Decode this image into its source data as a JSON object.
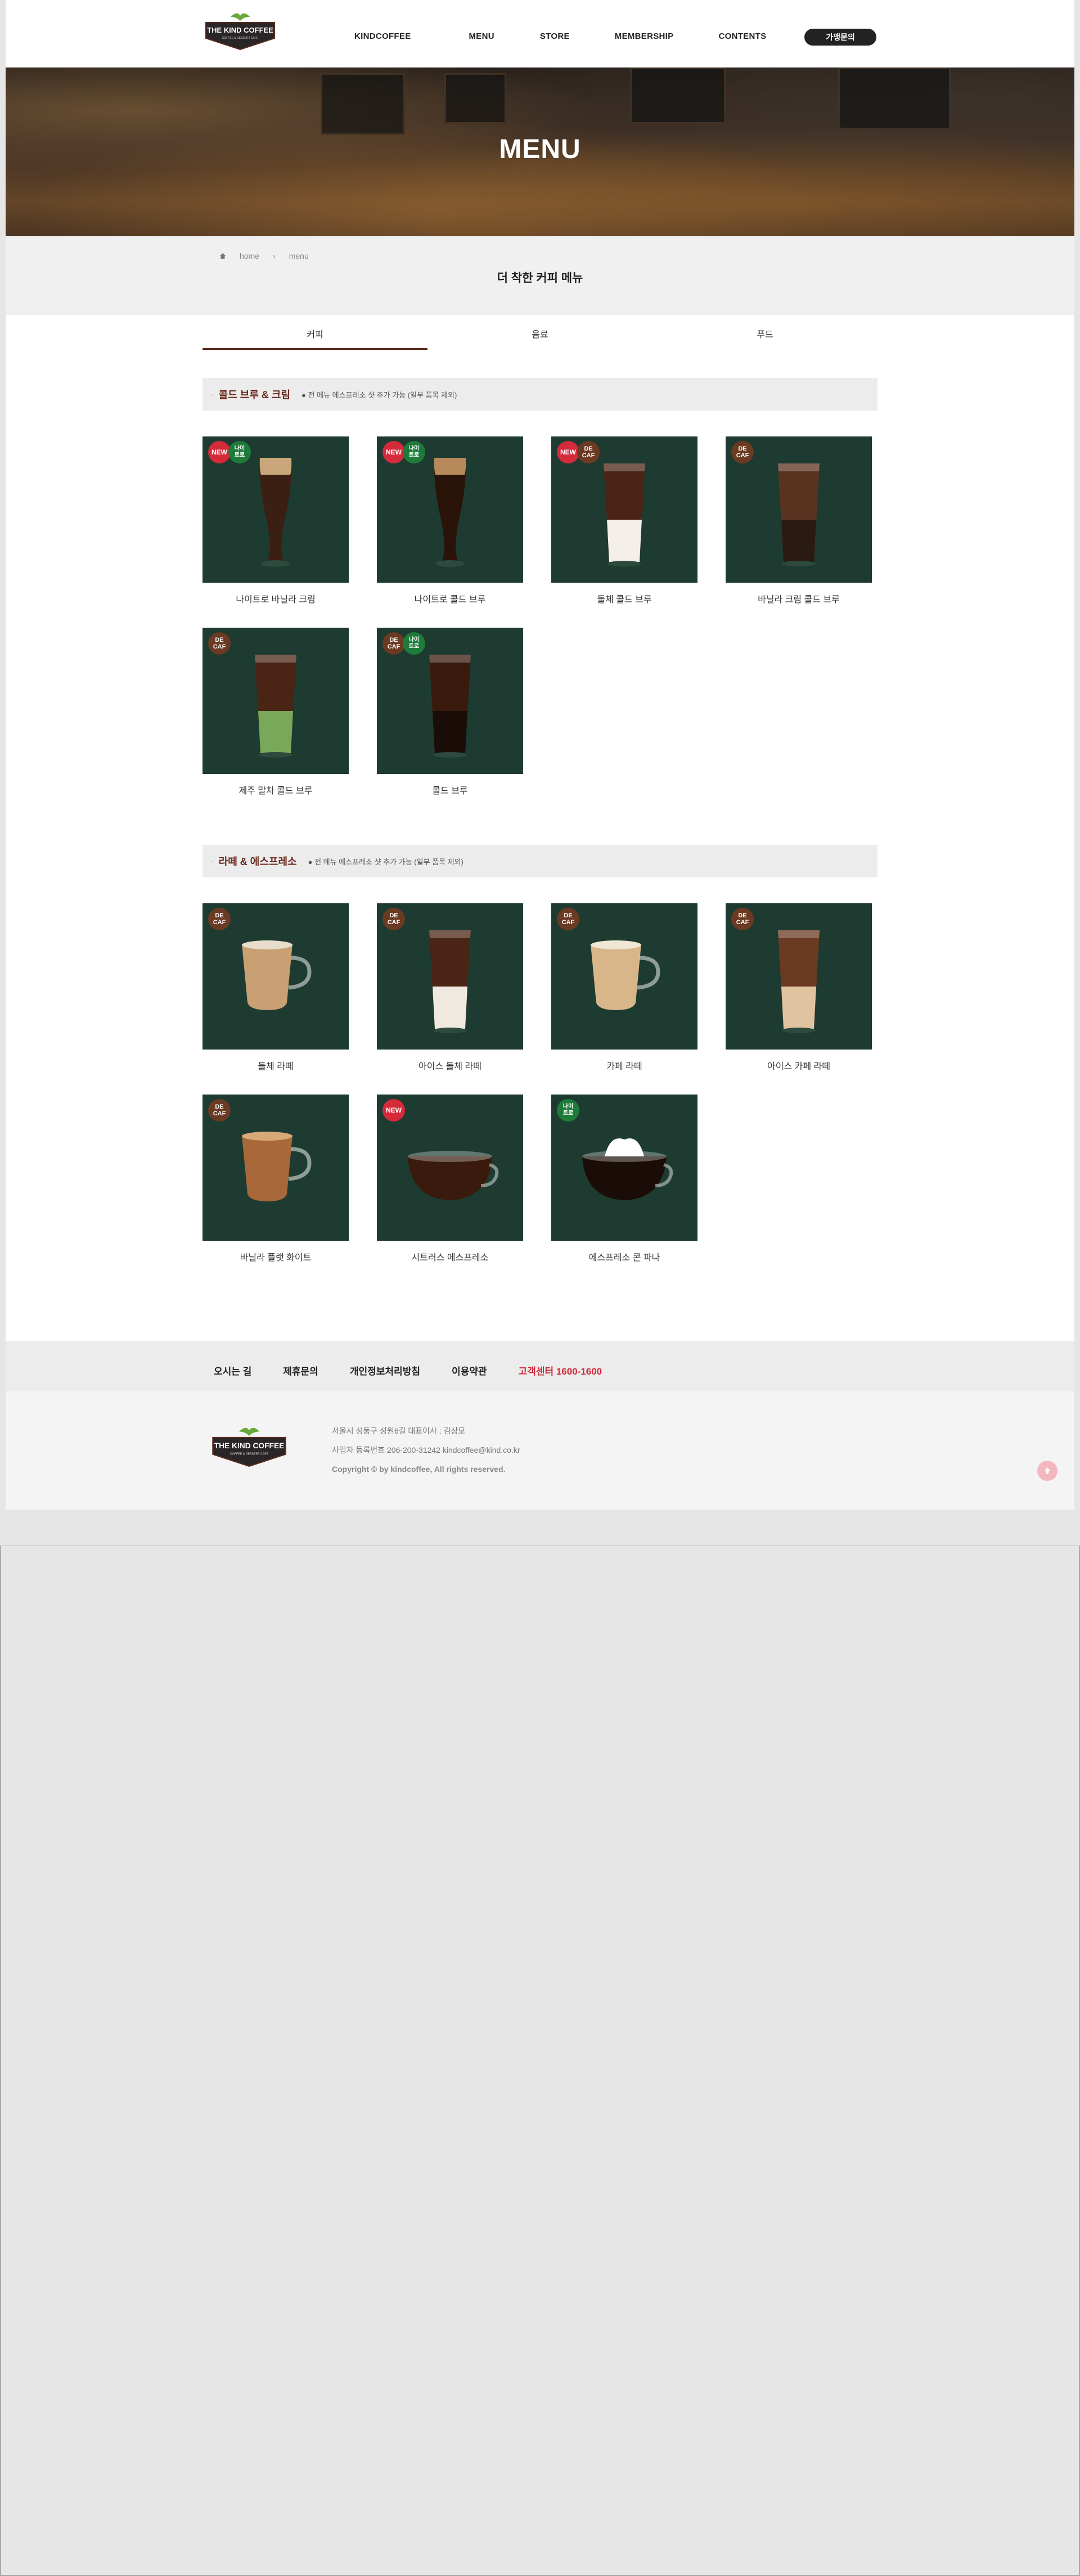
{
  "header": {
    "logo_text": "THE KIND COFFEE",
    "logo_sub": "COFFEE & DESSERT CAFE",
    "nav": [
      "KINDCOFFEE",
      "MENU",
      "STORE",
      "MEMBERSHIP",
      "CONTENTS"
    ],
    "cta_label": "가맹문의"
  },
  "hero": {
    "title": "MENU"
  },
  "breadcrumb": {
    "home": "home",
    "current": "menu"
  },
  "page_title": "더 착한 커피 메뉴",
  "tabs": [
    "커피",
    "음료",
    "푸드"
  ],
  "sections": [
    {
      "title": "콜드 브루 & 크림",
      "note": "전 메뉴 에스프레소 샷 추가 가능 (일부 품목 제외)",
      "items": [
        {
          "name": "나이트로 바닐라 크림",
          "badges": [
            "NEW",
            "나이트로"
          ]
        },
        {
          "name": "나이트로 콜드 브루",
          "badges": [
            "NEW",
            "나이트로"
          ]
        },
        {
          "name": "돌체 콜드 브루",
          "badges": [
            "NEW",
            "DECAF"
          ]
        },
        {
          "name": "바닐라 크림 콜드 브루",
          "badges": [
            "DECAF"
          ]
        },
        {
          "name": "제주 말차 콜드 브루",
          "badges": [
            "DECAF"
          ]
        },
        {
          "name": "콜드 브루",
          "badges": [
            "DECAF",
            "나이트로"
          ]
        }
      ]
    },
    {
      "title": "라떼 & 에스프레소",
      "note": "전 메뉴 에스프레소 샷 추가 가능 (일부 품목 제외)",
      "items": [
        {
          "name": "돌체 라떼",
          "badges": [
            "DECAF"
          ]
        },
        {
          "name": "아이스 돌체 라떼",
          "badges": [
            "DECAF"
          ]
        },
        {
          "name": "카페 라떼",
          "badges": [
            "DECAF"
          ]
        },
        {
          "name": "아이스 카페 라떼",
          "badges": [
            "DECAF"
          ]
        },
        {
          "name": "바닐라 플랫 화이트",
          "badges": [
            "DECAF"
          ]
        },
        {
          "name": "시트러스 에스프레소",
          "badges": [
            "NEW"
          ]
        },
        {
          "name": "에스프레소 콘 파나",
          "badges": [
            "나이트로"
          ]
        }
      ]
    }
  ],
  "badge_labels": {
    "new": "NEW",
    "decaf_top": "DE",
    "decaf_bottom": "CAF",
    "nitro_top": "나이",
    "nitro_bottom": "트로"
  },
  "footer": {
    "links": [
      "오시는 길",
      "제휴문의",
      "개인정보처리방침",
      "이용약관",
      "고객센터 1600-1600"
    ],
    "address": "서울시 성동구 성원6길 대표이사 : 김상모",
    "business": "사업자 등록번호 206-200-31242 kindcoffee@kind.co.kr",
    "copyright": "Copyright © by kindcoffee, All rights reserved."
  },
  "colors": {
    "accent": "#5a2a1a",
    "card_bg": "#1d3b31",
    "new": "#d42a3a",
    "decaf": "#6b3a22",
    "nitro": "#1e7b3a",
    "hotline": "#d42a3a"
  }
}
